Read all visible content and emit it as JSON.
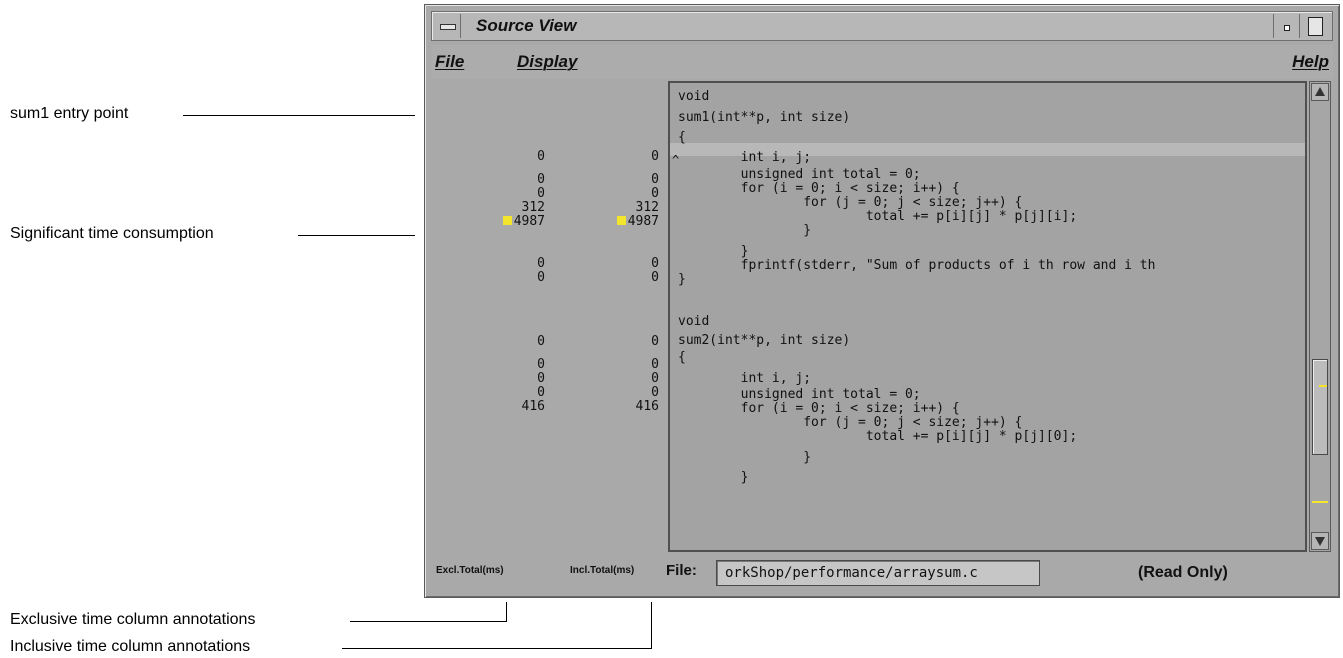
{
  "callouts": {
    "entry_point": "sum1 entry point",
    "time_consumption": "Significant time consumption",
    "exclusive_column": "Exclusive time column annotations",
    "inclusive_column": "Inclusive time column annotations"
  },
  "window": {
    "title": "Source View",
    "menu": {
      "file": "File",
      "display": "Display",
      "help": "Help"
    }
  },
  "metrics": {
    "excl": [
      "0",
      "0",
      "0",
      "312",
      "4987",
      "0",
      "0",
      "0",
      "0",
      "0",
      "0",
      "416"
    ],
    "incl": [
      "0",
      "0",
      "0",
      "312",
      "4987",
      "0",
      "0",
      "0",
      "0",
      "0",
      "0",
      "416"
    ]
  },
  "code": [
    "void",
    "sum1(int**p, int size)",
    "{",
    "        int i, j;",
    "        unsigned int total = 0;",
    "        for (i = 0; i < size; i++) {",
    "                for (j = 0; j < size; j++) {",
    "                        total += p[i][j] * p[j][i];",
    "                }",
    "        }",
    "        fprintf(stderr, \"Sum of products of i th row and i th",
    "}",
    "",
    "void",
    "sum2(int**p, int size)",
    "{",
    "        int i, j;",
    "        unsigned int total = 0;",
    "        for (i = 0; i < size; i++) {",
    "                for (j = 0; j < size; j++) {",
    "                        total += p[i][j] * p[j][0];",
    "                }",
    "        }"
  ],
  "footer": {
    "excl_label": "Excl.Total(ms)",
    "incl_label": "Incl.Total(ms)",
    "file_label": "File:",
    "file_value": "orkShop/performance/arraysum.c",
    "status": "(Read Only)"
  },
  "colors": {
    "highlight": "#f2e52c",
    "window_gray": "#a9a9a9"
  }
}
